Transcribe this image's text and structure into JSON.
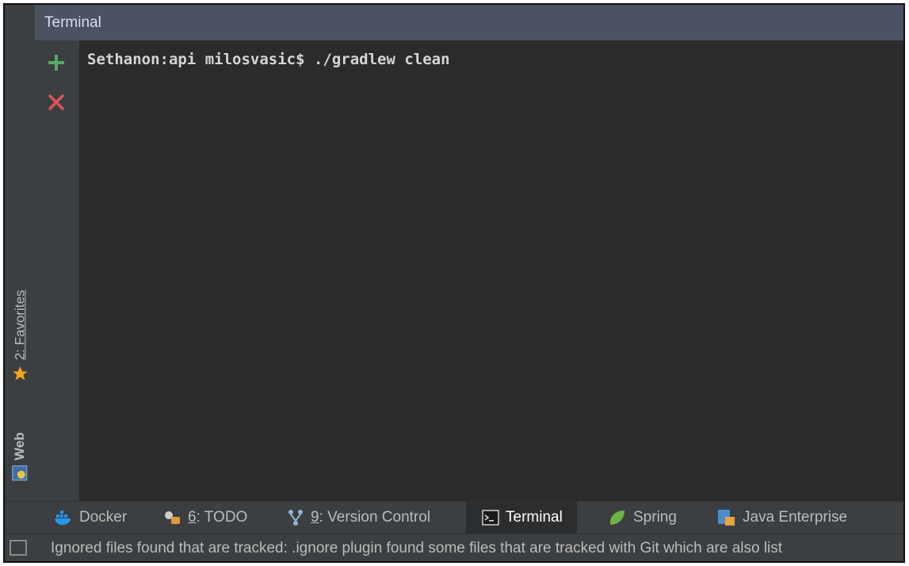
{
  "panel": {
    "title": "Terminal"
  },
  "terminal": {
    "prompt_line": "Sethanon:api milosvasic$ ./gradlew clean"
  },
  "toolbar": {
    "new_session_icon": "plus-icon",
    "close_session_icon": "close-icon"
  },
  "left_stripe": {
    "items": [
      {
        "label": "2: Favorites",
        "icon": "star-icon"
      },
      {
        "label": "Web",
        "icon": "web-icon"
      }
    ]
  },
  "tool_windows": [
    {
      "label": "Docker",
      "icon": "docker-icon",
      "active": false
    },
    {
      "label_prefix": "6",
      "label": ": TODO",
      "icon": "todo-icon",
      "active": false
    },
    {
      "label_prefix": "9",
      "label": ": Version Control",
      "icon": "version-control-icon",
      "active": false
    },
    {
      "label": "Terminal",
      "icon": "terminal-icon",
      "active": true
    },
    {
      "label": "Spring",
      "icon": "spring-icon",
      "active": false
    },
    {
      "label": "Java Enterprise",
      "icon": "java-enterprise-icon",
      "active": false
    }
  ],
  "status_bar": {
    "message": "Ignored files found that are tracked: .ignore plugin found some files that are tracked with Git which are also list"
  },
  "colors": {
    "header_bg": "#4b5363",
    "terminal_bg": "#2b2b2b",
    "ide_bg": "#3c3f41",
    "plus_green": "#59a869",
    "close_red": "#e05555"
  }
}
